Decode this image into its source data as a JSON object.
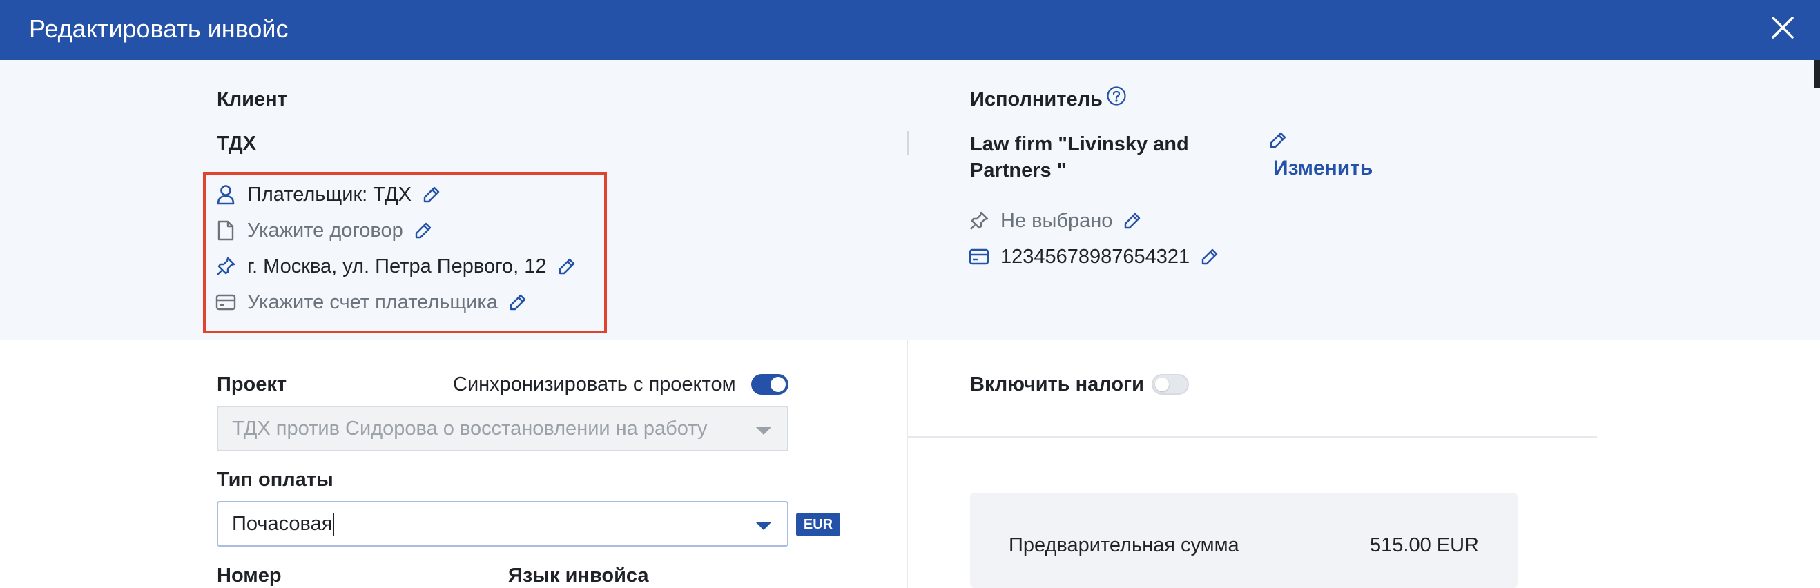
{
  "header": {
    "title": "Редактировать инвойс"
  },
  "client": {
    "section_label": "Клиент",
    "name": "ТДХ",
    "payer": "Плательщик: ТДХ",
    "contract_placeholder": "Укажите договор",
    "address": "г. Москва, ул. Петра Первого, 12",
    "account_placeholder": "Укажите счет плательщика"
  },
  "executor": {
    "section_label": "Исполнитель",
    "name": "Law firm \"Livinsky and Partners \"",
    "change_label": "Изменить",
    "address": "Не выбрано",
    "account": "12345678987654321"
  },
  "form": {
    "project_label": "Проект",
    "sync_label": "Синхронизировать с проектом",
    "sync_enabled": true,
    "project_value": "ТДХ против Сидорова о восстановлении на работу",
    "payment_type_label": "Тип оплаты",
    "payment_type_value": "Почасовая",
    "currency": "EUR",
    "number_label": "Номер",
    "language_label": "Язык инвойса"
  },
  "taxes": {
    "label": "Включить налоги",
    "enabled": false
  },
  "summary": {
    "preliminary_label": "Предварительная сумма",
    "preliminary_value": "515.00 EUR"
  },
  "colors": {
    "brand": "#2452a8",
    "highlight_border": "#e0442d",
    "band_bg": "#f4f7fc"
  },
  "icons": {
    "close": "close-icon",
    "person": "person-icon",
    "document": "document-icon",
    "pin": "pin-icon",
    "card": "credit-card-icon",
    "pencil": "pencil-icon",
    "help": "help-circle-icon",
    "caret": "chevron-down-icon"
  }
}
